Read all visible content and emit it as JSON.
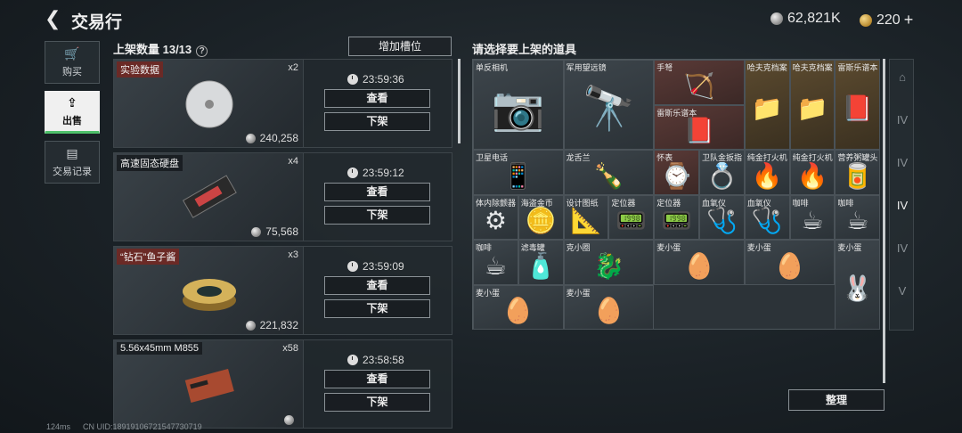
{
  "header": {
    "title": "交易行",
    "silver": "62,821K",
    "gold": "220",
    "plus": "+"
  },
  "sidenav": [
    {
      "label": "购买",
      "icon": "🛒"
    },
    {
      "label": "出售",
      "icon": "⇪"
    },
    {
      "label": "交易记录",
      "icon": "▤"
    }
  ],
  "listings_header": {
    "label": "上架数量 13/13",
    "help": "?"
  },
  "add_slot": "增加槽位",
  "view_label": "查看",
  "delist_label": "下架",
  "listings": [
    {
      "name": "实验数据",
      "qty": "x2",
      "price": "240,258",
      "timer": "23:59:36",
      "red": true
    },
    {
      "name": "高速固态硬盘",
      "qty": "x4",
      "price": "75,568",
      "timer": "23:59:12",
      "red": false
    },
    {
      "name": "“钻石”鱼子酱",
      "qty": "x3",
      "price": "221,832",
      "timer": "23:59:09",
      "red": true
    },
    {
      "name": "5.56x45mm M855",
      "qty": "x58",
      "price": "",
      "timer": "23:58:58",
      "red": false
    }
  ],
  "inventory_header": "请选择要上架的道具",
  "inventory": [
    {
      "name": "单反相机",
      "art": "📷"
    },
    {
      "name": "军用望远镜",
      "art": "🔭"
    },
    {
      "name": "手弩",
      "art": "🏹"
    },
    {
      "name": "哈夫克档案",
      "art": "📁"
    },
    {
      "name": "哈夫克档案",
      "art": "📁"
    },
    {
      "name": "雷斯乐谱本",
      "art": "📕"
    },
    {
      "name": "雷斯乐谱本",
      "art": "📕"
    },
    {
      "name": "卫星电话",
      "art": "📱"
    },
    {
      "name": "龙舌兰",
      "art": "🍾"
    },
    {
      "name": "怀表",
      "art": "⌚"
    },
    {
      "name": "卫队金扳指",
      "art": "💍"
    },
    {
      "name": "纯金打火机",
      "art": "🔥"
    },
    {
      "name": "纯金打火机",
      "art": "🔥"
    },
    {
      "name": "营养粥罐头",
      "art": "🥫"
    },
    {
      "name": "体内除颤器",
      "art": "⚙"
    },
    {
      "name": "海盗金币",
      "art": "🪙"
    },
    {
      "name": "设计图纸",
      "art": "📐"
    },
    {
      "name": "定位器",
      "art": "📟"
    },
    {
      "name": "定位器",
      "art": "📟"
    },
    {
      "name": "血氧仪",
      "art": "🩺"
    },
    {
      "name": "血氧仪",
      "art": "🩺"
    },
    {
      "name": "咖啡",
      "art": "☕"
    },
    {
      "name": "咖啡",
      "art": "☕"
    },
    {
      "name": "咖啡",
      "art": "☕"
    },
    {
      "name": "滤毒罐",
      "art": "🧴"
    },
    {
      "name": "克小圈",
      "art": "🐉"
    },
    {
      "name": "麦小蛋",
      "art": "🥚"
    },
    {
      "name": "麦小蛋",
      "art": "🥚"
    },
    {
      "name": "麦小蛋",
      "art": "🐰"
    },
    {
      "name": "麦小蛋",
      "art": "🥚"
    },
    {
      "name": "麦小蛋",
      "art": "🥚"
    }
  ],
  "right_tabs": [
    "⌂",
    "IV",
    "IV",
    "IV",
    "IV",
    "V"
  ],
  "sort_label": "整理",
  "status": {
    "ping": "124ms",
    "uid": "CN UID:18919106721547730719"
  }
}
